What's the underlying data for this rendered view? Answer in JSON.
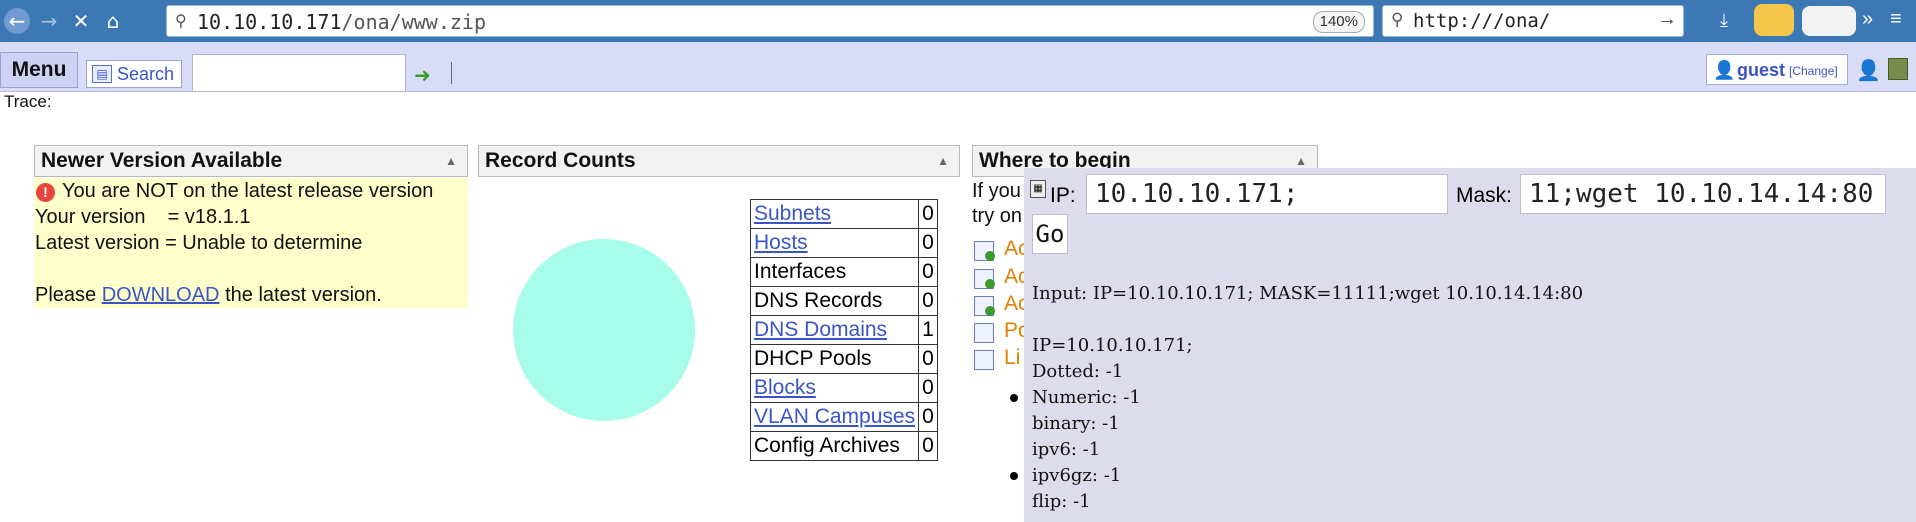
{
  "browser": {
    "url_host": "10.10.10.171",
    "url_path": "/ona/www.zip",
    "zoom": "140%",
    "search_text": "http:///ona/"
  },
  "app": {
    "menu_label": "Menu",
    "search_label": "Search",
    "search_value": "",
    "user_name": "guest",
    "user_change": "[Change]",
    "trace_label": "Trace:"
  },
  "newer_version": {
    "title": "Newer Version Available",
    "warning": "You are NOT on the latest release version",
    "your_version": "Your version    = v18.1.1",
    "latest_version": "Latest version = Unable to determine",
    "please": "Please",
    "download_link": "DOWNLOAD",
    "after_link": "the latest version."
  },
  "record_counts": {
    "title": "Record Counts",
    "rows": [
      {
        "label": "Subnets",
        "count": "0",
        "link": true
      },
      {
        "label": "Hosts",
        "count": "0",
        "link": true
      },
      {
        "label": "Interfaces",
        "count": "0",
        "link": false
      },
      {
        "label": "DNS Records",
        "count": "0",
        "link": false
      },
      {
        "label": "DNS Domains",
        "count": "1",
        "link": true
      },
      {
        "label": "DHCP Pools",
        "count": "0",
        "link": false
      },
      {
        "label": "Blocks",
        "count": "0",
        "link": true
      },
      {
        "label": "VLAN Campuses",
        "count": "0",
        "link": true
      },
      {
        "label": "Config Archives",
        "count": "0",
        "link": false
      }
    ],
    "pie_color": "#a8fcea"
  },
  "where_to_begin": {
    "title": "Where to begin",
    "line1": "If you",
    "line2": "try on",
    "items": [
      "Ac",
      "Ac",
      "Ac",
      "Po",
      "Li"
    ]
  },
  "calc_popup": {
    "ip_label": "IP:",
    "ip_value": "10.10.10.171;",
    "mask_label": "Mask:",
    "mask_value": "11;wget 10.10.14.14:80",
    "go_label": "Go",
    "input_line": "Input: IP=10.10.10.171; MASK=11111;wget 10.10.14.14:80",
    "ip_line": "IP=10.10.10.171;",
    "results": [
      "Dotted: -1",
      "Numeric: -1",
      "binary: -1",
      "ipv6: -1",
      "ipv6gz: -1",
      "flip: -1"
    ]
  }
}
